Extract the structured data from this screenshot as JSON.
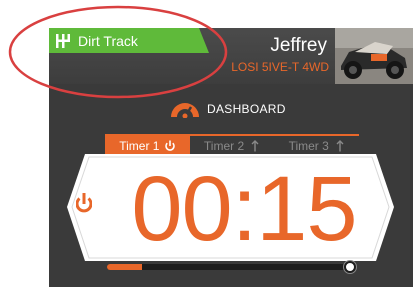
{
  "header": {
    "track_name": "Dirt Track",
    "driver_name": "Jeffrey",
    "vehicle_name": "LOSI 5IVE-T 4WD",
    "track_icon": "gear-shift-icon",
    "photo_icon": "car-photo"
  },
  "section": {
    "label": "DASHBOARD",
    "icon": "speedometer-icon"
  },
  "timers": {
    "tabs": [
      {
        "label": "Timer 1",
        "active": true,
        "icon": "power-icon"
      },
      {
        "label": "Timer 2",
        "active": false,
        "icon": "arrow-up-icon"
      },
      {
        "label": "Timer 3",
        "active": false,
        "icon": "arrow-up-icon"
      }
    ],
    "display_value": "00:15",
    "progress": 0.14
  },
  "colors": {
    "accent": "#e8672a",
    "track_tab": "#5fba3a",
    "background": "#3a3a3a",
    "annotation": "#d94040"
  }
}
